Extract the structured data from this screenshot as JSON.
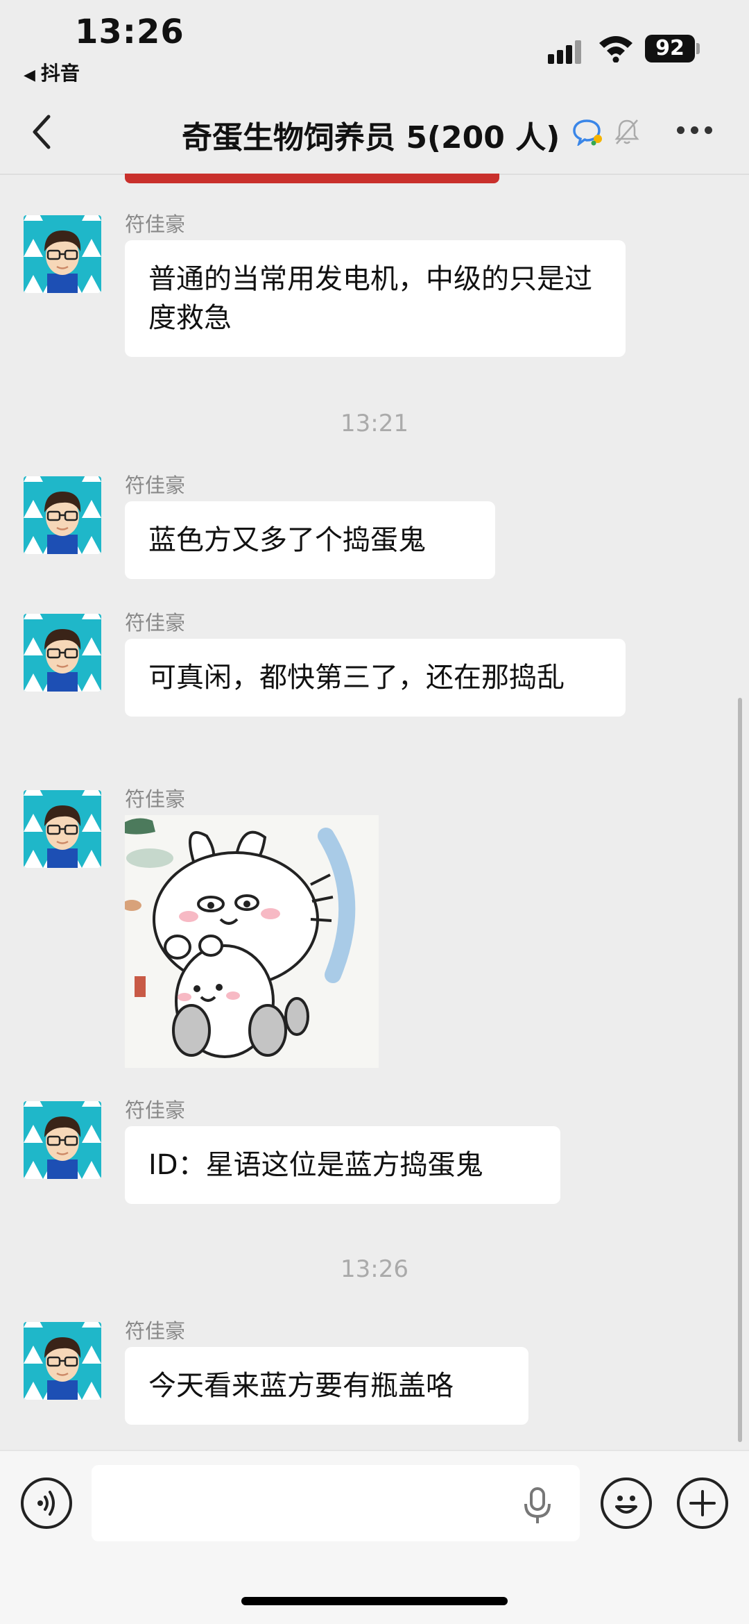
{
  "status_bar": {
    "time": "13:26",
    "back_app": "抖音",
    "battery": "92",
    "icons": [
      "signal-icon",
      "wifi-icon",
      "battery-icon"
    ]
  },
  "header": {
    "title": "奇蛋生物饲养员 5(200 人)",
    "icons": [
      "back-arrow-icon",
      "group-chat-icon",
      "mute-bell-icon",
      "more-icon"
    ]
  },
  "messages": [
    {
      "sender": "符佳豪",
      "text": "普通的当常用发电机，中级的只是过度救急"
    },
    {
      "timestamp": "13:21"
    },
    {
      "sender": "符佳豪",
      "text": "蓝色方又多了个捣蛋鬼"
    },
    {
      "sender": "符佳豪",
      "text": "可真闲，都快第三了，还在那捣乱"
    },
    {
      "sender": "符佳豪",
      "type": "sticker"
    },
    {
      "sender": "符佳豪",
      "text": "ID：星语这位是蓝方捣蛋鬼"
    },
    {
      "timestamp": "13:26"
    },
    {
      "sender": "符佳豪",
      "text": "今天看来蓝方要有瓶盖咯"
    }
  ],
  "input_bar": {
    "value": "",
    "icons": [
      "voice-toggle-icon",
      "microphone-icon",
      "emoji-icon",
      "plus-icon"
    ]
  },
  "colors": {
    "background": "#ededed",
    "bubble": "#ffffff",
    "sender_text": "#888888",
    "timestamp_text": "#aaaaaa",
    "red_strip": "#c9302c"
  }
}
